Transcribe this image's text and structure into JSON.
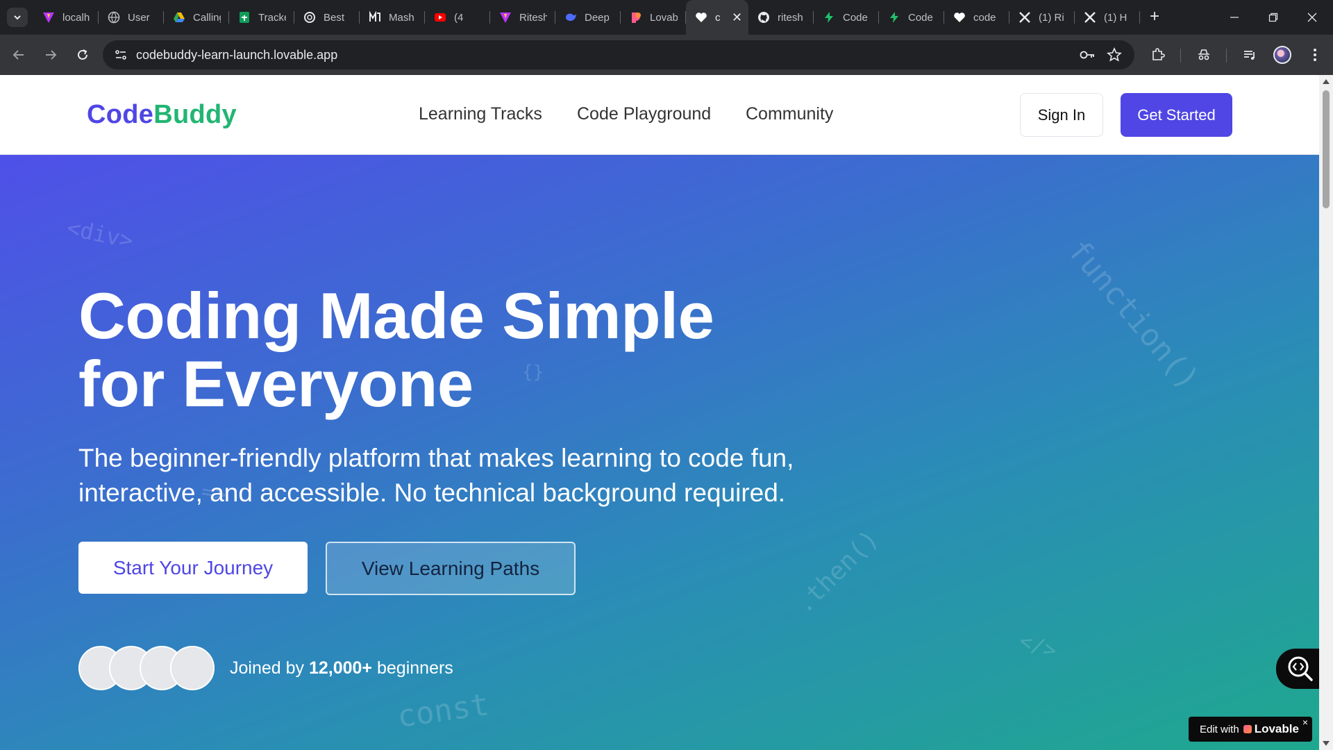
{
  "browser": {
    "tabs": [
      {
        "title": "localhost",
        "icon": "vite-icon"
      },
      {
        "title": "User",
        "icon": "globe-icon"
      },
      {
        "title": "Calling",
        "icon": "google-drive-icon"
      },
      {
        "title": "Tracker",
        "icon": "google-sheets-icon"
      },
      {
        "title": "Best",
        "icon": "openai-icon"
      },
      {
        "title": "Mash",
        "icon": "mashable-icon"
      },
      {
        "title": "(4",
        "icon": "youtube-icon"
      },
      {
        "title": "Ritesh",
        "icon": "vite-icon"
      },
      {
        "title": "Deep",
        "icon": "deepseek-icon"
      },
      {
        "title": "Lovable",
        "icon": "lovable-icon"
      },
      {
        "title": "c",
        "icon": "heart-icon",
        "active": true
      },
      {
        "title": "ritesh",
        "icon": "github-icon"
      },
      {
        "title": "Code",
        "icon": "bolt-icon"
      },
      {
        "title": "Code",
        "icon": "bolt-icon"
      },
      {
        "title": "code",
        "icon": "heart-icon"
      },
      {
        "title": "(1) Ri",
        "icon": "x-icon"
      },
      {
        "title": "(1) H",
        "icon": "x-icon"
      }
    ],
    "url": "codebuddy-learn-launch.lovable.app"
  },
  "site": {
    "logo_part1": "Code",
    "logo_part2": "Buddy",
    "nav": [
      "Learning Tracks",
      "Code Playground",
      "Community"
    ],
    "sign_in": "Sign In",
    "get_started": "Get Started",
    "brand_color": "#4f46e5",
    "accent_color": "#22b573"
  },
  "hero": {
    "title_line1": "Coding Made Simple",
    "title_for": "for ",
    "title_highlight": "Everyone",
    "subtitle": "The beginner-friendly platform that makes learning to code fun, interactive, and accessible. No technical background required.",
    "cta_primary": "Start Your Journey",
    "cta_secondary": "View Learning Paths",
    "joined_prefix": "Joined by ",
    "joined_count": "12,000+",
    "joined_suffix": " beginners",
    "decorations": [
      "<div>",
      "function()",
      "{}",
      ".then()",
      "</>",
      "const",
      "=>"
    ]
  },
  "badge": {
    "edit_with": "Edit with",
    "brand": "Lovable",
    "close": "×"
  }
}
